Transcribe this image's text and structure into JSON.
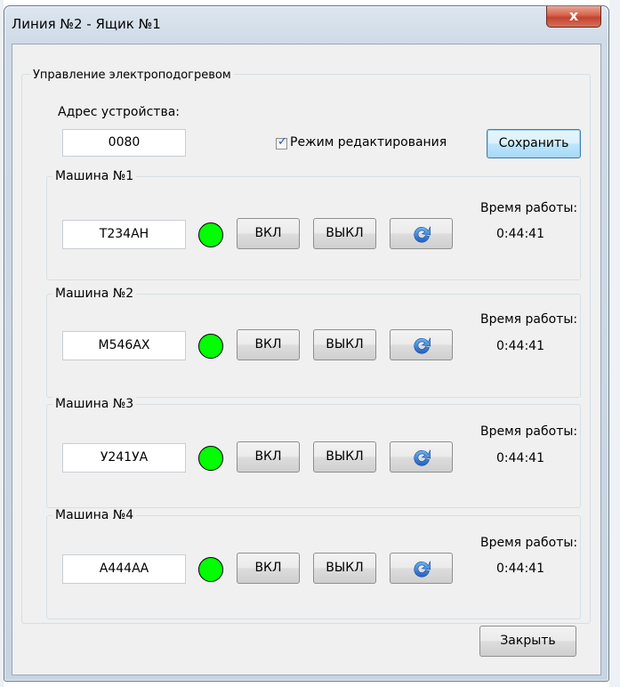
{
  "window": {
    "title": "Линия №2 - Ящик №1",
    "close_glyph": "x"
  },
  "group": {
    "title": "Управление электроподогревом"
  },
  "address": {
    "label": "Адрес устройства:",
    "value": "0080"
  },
  "edit_mode": {
    "label": "Режим редактирования",
    "checked": true
  },
  "save_label": "Сохранить",
  "machines": [
    {
      "title": "Машина №1",
      "plate": "Т234АН",
      "on_label": "ВКЛ",
      "off_label": "ВЫКЛ",
      "uptime_label": "Время работы:",
      "uptime": "0:44:41",
      "status_color": "#00ff00",
      "refresh_icon": "refresh-icon"
    },
    {
      "title": "Машина №2",
      "plate": "М546АХ",
      "on_label": "ВКЛ",
      "off_label": "ВЫКЛ",
      "uptime_label": "Время работы:",
      "uptime": "0:44:41",
      "status_color": "#00ff00",
      "refresh_icon": "refresh-icon"
    },
    {
      "title": "Машина №3",
      "plate": "У241УА",
      "on_label": "ВКЛ",
      "off_label": "ВЫКЛ",
      "uptime_label": "Время работы:",
      "uptime": "0:44:41",
      "status_color": "#00ff00",
      "refresh_icon": "refresh-icon"
    },
    {
      "title": "Машина №4",
      "plate": "А444АА",
      "on_label": "ВКЛ",
      "off_label": "ВЫКЛ",
      "uptime_label": "Время работы:",
      "uptime": "0:44:41",
      "status_color": "#00ff00",
      "refresh_icon": "refresh-icon"
    }
  ],
  "close_label": "Закрыть"
}
